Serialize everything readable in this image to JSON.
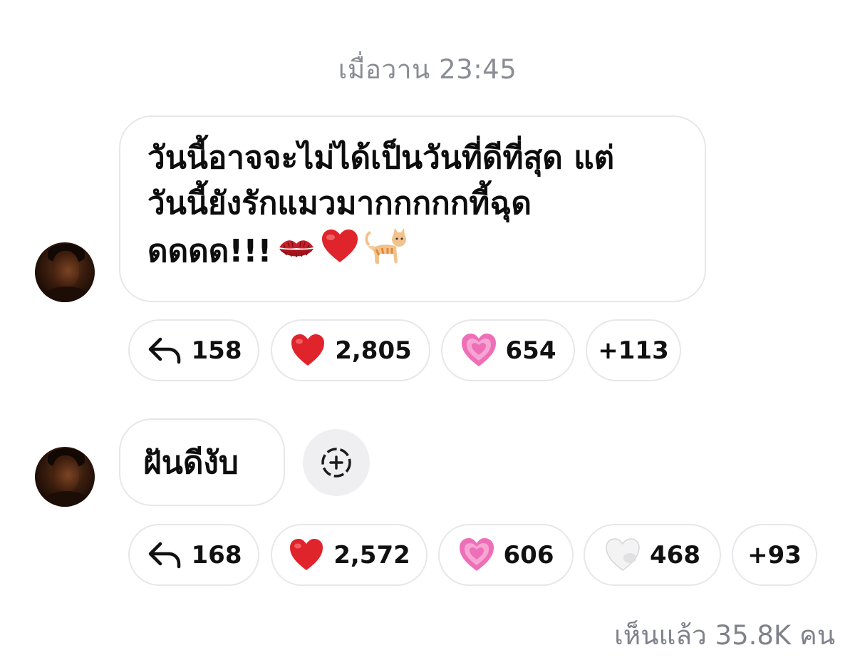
{
  "timestamp": "เมื่อวาน 23:45",
  "messages": [
    {
      "lines": [
        "วันนี้อาจจะไม่ได้เป็นวันที่ดีที่สุด แต่",
        "วันนี้ยังรักแมวมากกกกกที้ฉุด",
        "ดดดด!!!"
      ],
      "emojis": [
        "kiss-mark-icon",
        "red-heart-icon",
        "cat-icon"
      ],
      "reactions": [
        {
          "icon": "reply-arrow-icon",
          "count": "158"
        },
        {
          "icon": "red-heart-icon",
          "count": "2,805"
        },
        {
          "icon": "growing-heart-icon",
          "count": "654"
        },
        {
          "icon": "",
          "count": "+113"
        }
      ]
    },
    {
      "lines": [
        "ฝันดีงับ"
      ],
      "reactions": [
        {
          "icon": "reply-arrow-icon",
          "count": "168"
        },
        {
          "icon": "red-heart-icon",
          "count": "2,572"
        },
        {
          "icon": "growing-heart-icon",
          "count": "606"
        },
        {
          "icon": "white-heart-icon",
          "count": "468"
        },
        {
          "icon": "",
          "count": "+93"
        }
      ]
    }
  ],
  "seen_label": "เห็นแล้ว 35.8K คน",
  "colors": {
    "heart_red": "#e0242b",
    "heart_pink": "#ee6fb8",
    "meta_gray": "#8a8d94",
    "border_gray": "#e6e7ea"
  }
}
